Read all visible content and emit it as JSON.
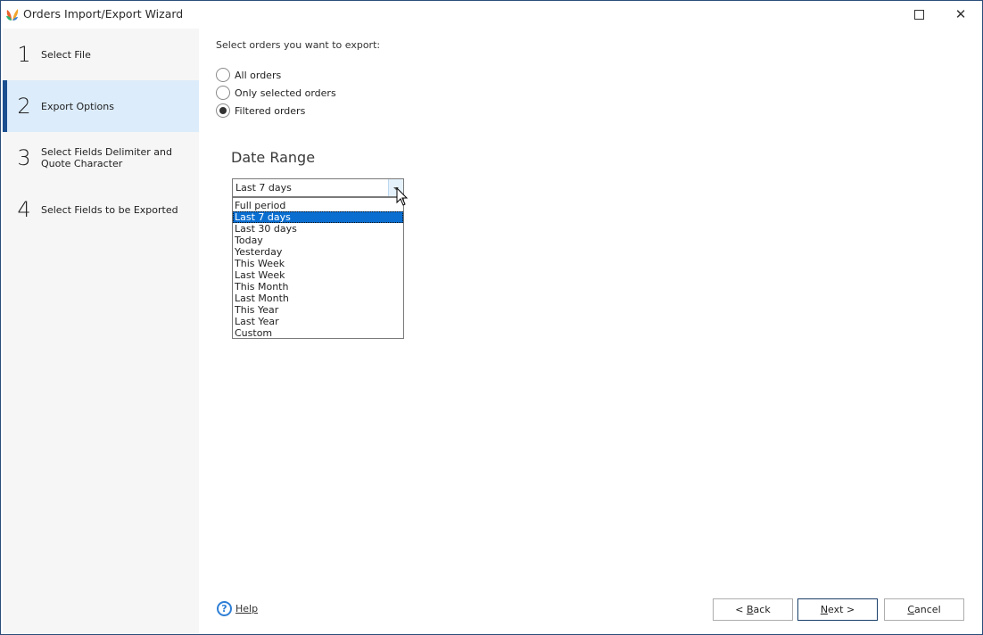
{
  "window": {
    "title": "Orders Import/Export Wizard",
    "icon": "app-logo-icon",
    "controls": {
      "maximize_icon": "maximize-icon",
      "close_icon": "close-icon",
      "close_glyph": "✕"
    }
  },
  "sidebar": {
    "steps": [
      {
        "number": "1",
        "label": "Select File",
        "active": false
      },
      {
        "number": "2",
        "label": "Export Options",
        "active": true
      },
      {
        "number": "3",
        "label": "Select Fields Delimiter and Quote Character",
        "active": false
      },
      {
        "number": "4",
        "label": "Select Fields to be Exported",
        "active": false
      }
    ]
  },
  "main": {
    "prompt": "Select orders you want to export:",
    "radio_options": [
      {
        "label": "All orders",
        "checked": false
      },
      {
        "label": "Only selected orders",
        "checked": false
      },
      {
        "label": "Filtered orders",
        "checked": true
      }
    ],
    "date_range": {
      "title": "Date Range",
      "selected_value": "Last 7 days",
      "options": [
        "Full period",
        "Last 7 days",
        "Last 30 days",
        "Today",
        "Yesterday",
        "This Week",
        "Last Week",
        "This Month",
        "Last Month",
        "This Year",
        "Last Year",
        "Custom"
      ],
      "highlighted_option": "Last 7 days"
    }
  },
  "footer": {
    "help": {
      "icon": "help-circle-icon",
      "glyph": "?",
      "label": "Help"
    },
    "back": {
      "prefix": "< ",
      "mnemonic": "B",
      "rest": "ack"
    },
    "next": {
      "mnemonic": "N",
      "rest": "ext >"
    },
    "cancel": {
      "mnemonic": "C",
      "rest": "ancel"
    }
  },
  "colors": {
    "accent": "#1b4f8f",
    "active_step_bg": "#dcecfb",
    "selection": "#0a6ed1",
    "sidebar_bg": "#f6f6f6",
    "window_border": "#2b4d78"
  }
}
